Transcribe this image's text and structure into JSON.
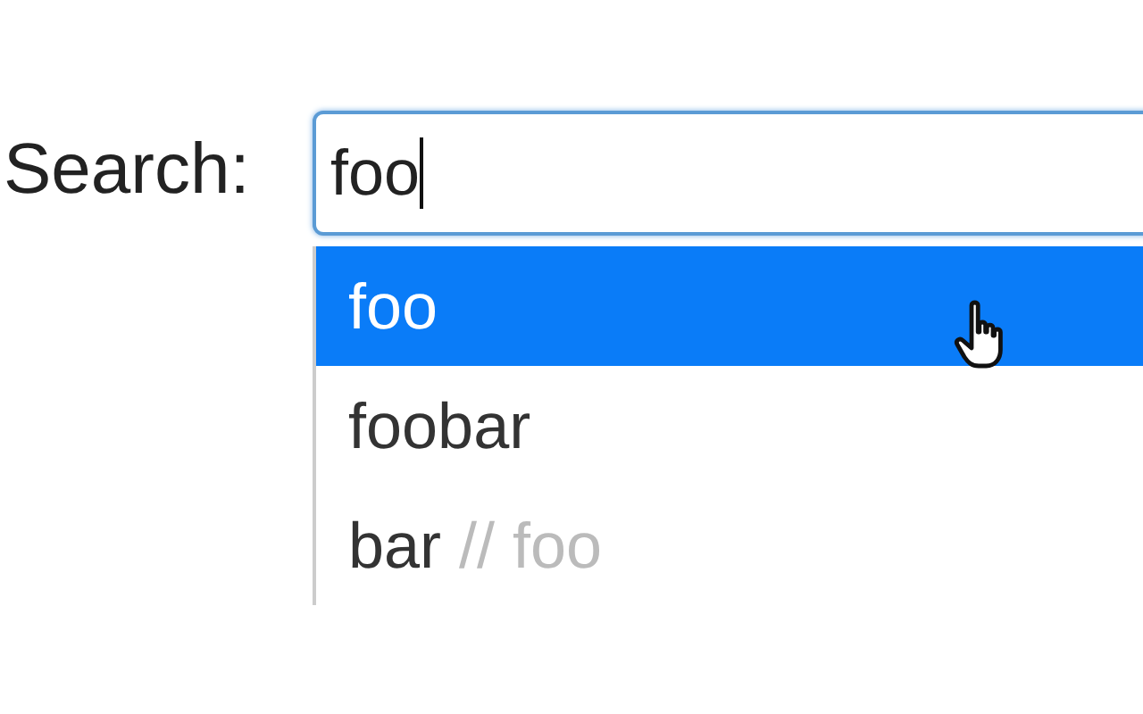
{
  "search": {
    "label": "Search:",
    "value": "foo"
  },
  "suggestions": [
    {
      "text": "foo",
      "selected": true
    },
    {
      "text": "foobar",
      "selected": false
    },
    {
      "text": "bar",
      "note": "// foo",
      "selected": false
    }
  ]
}
